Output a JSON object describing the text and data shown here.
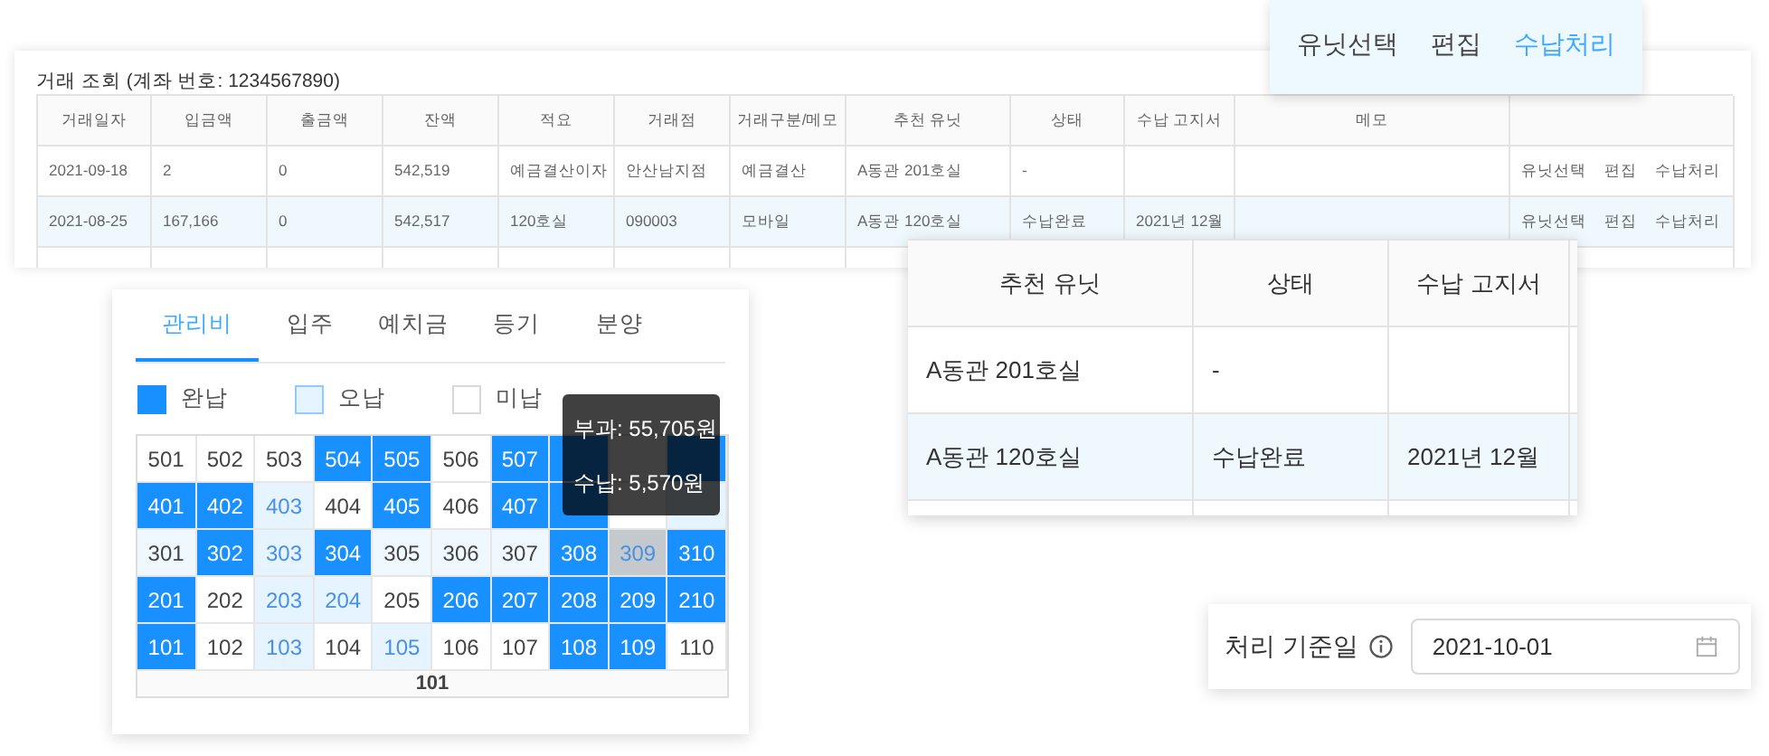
{
  "transactions": {
    "title": "거래 조회 (계좌 번호: 1234567890)",
    "columns": [
      "거래일자",
      "입금액",
      "출금액",
      "잔액",
      "적요",
      "거래점",
      "거래구분/메모",
      "추천 유닛",
      "상태",
      "수납 고지서",
      "메모"
    ],
    "rows": [
      {
        "selected": false,
        "date": "2021-09-18",
        "deposit": "2",
        "withdrawal": "0",
        "balance": "542,519",
        "summary": "예금결산이자",
        "branch": "안산남지점",
        "memo_type": "예금결산",
        "unit": "A동관 201호실",
        "status": "-",
        "actions": [
          "유닛선택",
          "편집",
          "수납처리"
        ]
      },
      {
        "selected": true,
        "date": "2021-08-25",
        "deposit": "167,166",
        "withdrawal": "0",
        "balance": "542,517",
        "summary": "120호실",
        "branch": "090003",
        "memo_type": "모바일",
        "unit": "A동관 120호실",
        "status": "수납완료",
        "notice": "2021년 12월",
        "actions": [
          "유닛선택",
          "편집",
          "수납처리"
        ]
      }
    ]
  },
  "action_popup": {
    "actions": [
      {
        "label": "유닛선택",
        "selected": false
      },
      {
        "label": "편집",
        "selected": false
      },
      {
        "label": "수납처리",
        "selected": true
      }
    ]
  },
  "zoom_table": {
    "columns": [
      "추천 유닛",
      "상태",
      "수납 고지서"
    ],
    "rows": [
      {
        "selected": false,
        "unit": "A동관 201호실",
        "status": "-"
      },
      {
        "selected": true,
        "unit": "A동관 120호실",
        "status": "수납완료",
        "notice": "2021년 12월"
      }
    ]
  },
  "unit_panel": {
    "tabs": [
      {
        "label": "관리비",
        "selected": true
      },
      {
        "label": "입주",
        "selected": false
      },
      {
        "label": "예치금",
        "selected": false
      },
      {
        "label": "등기",
        "selected": false
      },
      {
        "label": "분양",
        "selected": false
      }
    ],
    "legend": [
      {
        "kind": "paid",
        "label": "완납"
      },
      {
        "kind": "over",
        "label": "오납"
      },
      {
        "kind": "unpaid",
        "label": "미납"
      }
    ],
    "floors": [
      {
        "hovered": false,
        "units": [
          {
            "label": "501",
            "kind": "unpaid",
            "hovered": false
          },
          {
            "label": "502",
            "kind": "unpaid",
            "hovered": false
          },
          {
            "label": "503",
            "kind": "unpaid",
            "hovered": false
          },
          {
            "label": "504",
            "kind": "paid",
            "hovered": false
          },
          {
            "label": "505",
            "kind": "paid",
            "hovered": false
          },
          {
            "label": "506",
            "kind": "unpaid",
            "hovered": false
          },
          {
            "label": "507",
            "kind": "paid",
            "hovered": false
          },
          {
            "kind": "paid",
            "hovered": false
          },
          {
            "kind": "unpaid",
            "hovered": false
          },
          {
            "kind": "paid",
            "hovered": false
          }
        ]
      },
      {
        "hovered": false,
        "units": [
          {
            "label": "401",
            "kind": "paid",
            "hovered": false
          },
          {
            "label": "402",
            "kind": "paid",
            "hovered": false
          },
          {
            "label": "403",
            "kind": "over",
            "hovered": false
          },
          {
            "label": "404",
            "kind": "unpaid",
            "hovered": false
          },
          {
            "label": "405",
            "kind": "paid",
            "hovered": false
          },
          {
            "label": "406",
            "kind": "unpaid",
            "hovered": false
          },
          {
            "label": "407",
            "kind": "paid",
            "hovered": false
          },
          {
            "kind": "paid",
            "hovered": false
          },
          {
            "kind": "unpaid",
            "hovered": false
          },
          {
            "kind": "over",
            "hovered": false
          }
        ]
      },
      {
        "hovered": true,
        "units": [
          {
            "label": "301",
            "kind": "unpaid",
            "hovered": false
          },
          {
            "label": "302",
            "kind": "paid",
            "hovered": false
          },
          {
            "label": "303",
            "kind": "over",
            "hovered": false
          },
          {
            "label": "304",
            "kind": "paid",
            "hovered": false
          },
          {
            "label": "305",
            "kind": "unpaid",
            "hovered": false
          },
          {
            "label": "306",
            "kind": "unpaid",
            "hovered": false
          },
          {
            "label": "307",
            "kind": "unpaid",
            "hovered": false
          },
          {
            "label": "308",
            "kind": "paid",
            "hovered": false
          },
          {
            "label": "309",
            "kind": "over",
            "hovered": true
          },
          {
            "label": "310",
            "kind": "paid",
            "hovered": false
          }
        ]
      },
      {
        "hovered": false,
        "units": [
          {
            "label": "201",
            "kind": "paid",
            "hovered": false
          },
          {
            "label": "202",
            "kind": "unpaid",
            "hovered": false
          },
          {
            "label": "203",
            "kind": "over",
            "hovered": false
          },
          {
            "label": "204",
            "kind": "over",
            "hovered": false
          },
          {
            "label": "205",
            "kind": "unpaid",
            "hovered": false
          },
          {
            "label": "206",
            "kind": "paid",
            "hovered": false
          },
          {
            "label": "207",
            "kind": "paid",
            "hovered": false
          },
          {
            "label": "208",
            "kind": "paid",
            "hovered": false
          },
          {
            "label": "209",
            "kind": "paid",
            "hovered": false
          },
          {
            "label": "210",
            "kind": "paid",
            "hovered": false
          }
        ]
      },
      {
        "hovered": false,
        "units": [
          {
            "label": "101",
            "kind": "paid",
            "hovered": false
          },
          {
            "label": "102",
            "kind": "unpaid",
            "hovered": false
          },
          {
            "label": "103",
            "kind": "over",
            "hovered": false
          },
          {
            "label": "104",
            "kind": "unpaid",
            "hovered": false
          },
          {
            "label": "105",
            "kind": "over",
            "hovered": false
          },
          {
            "label": "106",
            "kind": "unpaid",
            "hovered": false
          },
          {
            "label": "107",
            "kind": "unpaid",
            "hovered": false
          },
          {
            "label": "108",
            "kind": "paid",
            "hovered": false
          },
          {
            "label": "109",
            "kind": "paid",
            "hovered": false
          },
          {
            "label": "110",
            "kind": "unpaid",
            "hovered": false
          }
        ]
      }
    ],
    "building": "101",
    "tooltip": {
      "lines": [
        "부과: 55,705원",
        "수납: 5,570원"
      ]
    }
  },
  "date_filter": {
    "label": "처리 기준일",
    "value": "2021-10-01"
  }
}
